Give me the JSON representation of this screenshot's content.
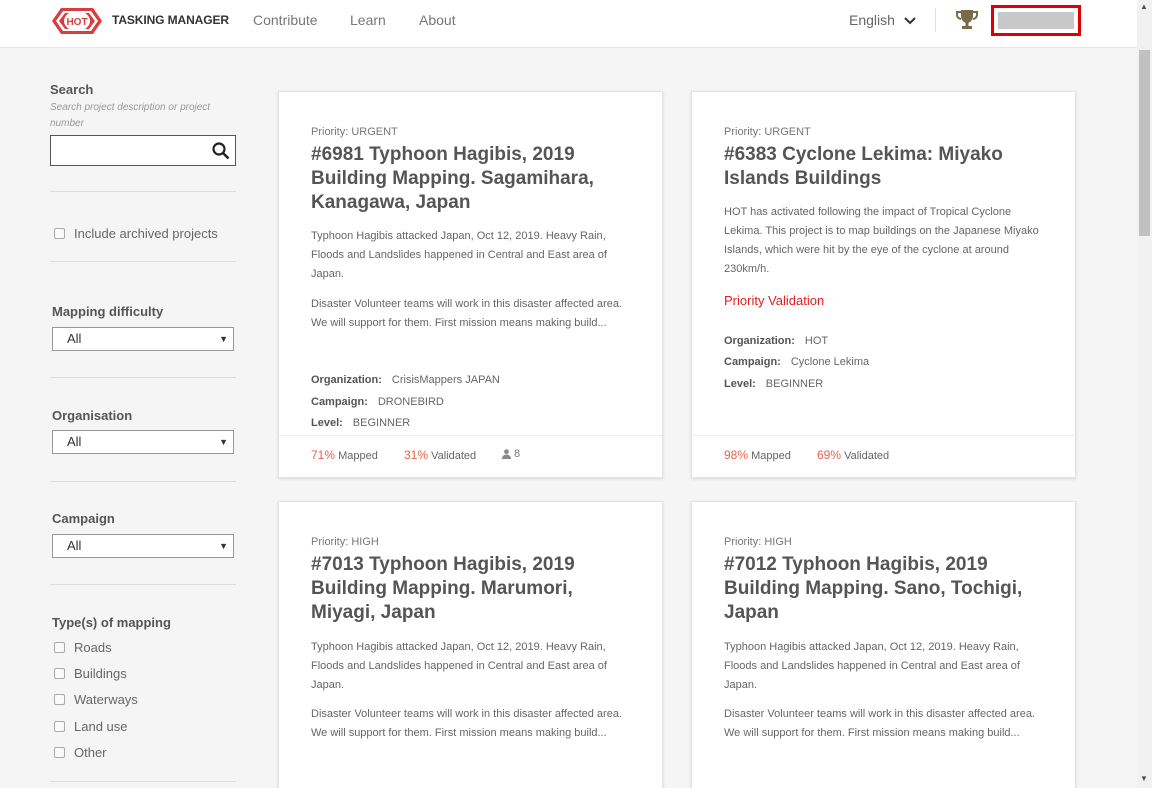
{
  "header": {
    "logo_text": "HOT",
    "brand": "TASKING MANAGER",
    "nav": [
      "Contribute",
      "Learn",
      "About"
    ],
    "language": "English",
    "colors": {
      "brand_red": "#d73f3f",
      "accent": "#e8624a",
      "highlight": "#e00000"
    }
  },
  "sidebar": {
    "search_label": "Search",
    "search_hint": "Search project description or project number",
    "search_value": "",
    "archived_label": "Include archived projects",
    "difficulty_label": "Mapping difficulty",
    "difficulty_value": "All",
    "organisation_label": "Organisation",
    "organisation_value": "All",
    "campaign_label": "Campaign",
    "campaign_value": "All",
    "types_label": "Type(s) of mapping",
    "types": [
      "Roads",
      "Buildings",
      "Waterways",
      "Land use",
      "Other"
    ]
  },
  "cards": [
    {
      "priority": "Priority: URGENT",
      "title": "#6981 Typhoon Hagibis, 2019 Building Mapping. Sagamihara, Kanagawa, Japan",
      "desc1": "Typhoon Hagibis attacked Japan, Oct 12, 2019. Heavy Rain, Floods and Landslides happened in Central and East area of Japan.",
      "desc2": "Disaster Volunteer teams will work in this disaster affected area. We will support for them. First mission means making build...",
      "org_label": "Organization:",
      "org": "CrisisMappers JAPAN",
      "campaign_label": "Campaign:",
      "campaign": "DRONEBIRD",
      "level_label": "Level:",
      "level": "BEGINNER",
      "mapped_pct": "71%",
      "mapped_label": "Mapped",
      "validated_pct": "31%",
      "validated_label": "Validated",
      "contributors": "8"
    },
    {
      "priority": "Priority: URGENT",
      "title": "#6383 Cyclone Lekima: Miyako Islands Buildings",
      "desc1": "HOT has activated following the impact of Tropical Cyclone Lekima. This project is to map buildings on the Japanese Miyako Islands, which were hit by the eye of the cyclone at around 230km/h.",
      "priority_validation": "Priority Validation",
      "org_label": "Organization:",
      "org": "HOT",
      "campaign_label": "Campaign:",
      "campaign": "Cyclone Lekima",
      "level_label": "Level:",
      "level": "BEGINNER",
      "mapped_pct": "98%",
      "mapped_label": "Mapped",
      "validated_pct": "69%",
      "validated_label": "Validated"
    },
    {
      "priority": "Priority: HIGH",
      "title": "#7013 Typhoon Hagibis, 2019 Building Mapping. Marumori, Miyagi, Japan",
      "desc1": "Typhoon Hagibis attacked Japan, Oct 12, 2019. Heavy Rain, Floods and Landslides happened in Central and East area of Japan.",
      "desc2": "Disaster Volunteer teams will work in this disaster affected area. We will support for them. First mission means making build..."
    },
    {
      "priority": "Priority: HIGH",
      "title": "#7012 Typhoon Hagibis, 2019 Building Mapping. Sano, Tochigi, Japan",
      "desc1": "Typhoon Hagibis attacked Japan, Oct 12, 2019. Heavy Rain, Floods and Landslides happened in Central and East area of Japan.",
      "desc2": "Disaster Volunteer teams will work in this disaster affected area. We will support for them. First mission means making build..."
    }
  ]
}
